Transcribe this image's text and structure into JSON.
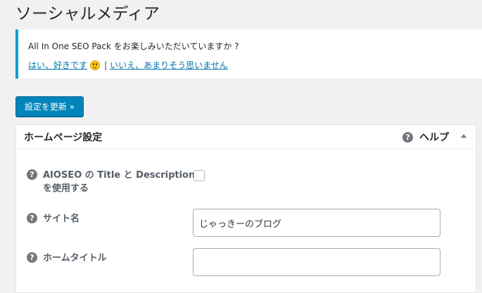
{
  "page": {
    "title": "ソーシャルメディア"
  },
  "notice": {
    "question": "All In One SEO Pack をお楽しみいただいていますか ?",
    "yes_link": "はい、好きです",
    "separator": "|",
    "no_link": "いいえ、あまりそう思いません"
  },
  "toolbar": {
    "update_label": "設定を更新 »"
  },
  "panel": {
    "title": "ホームページ設定",
    "help_label": "ヘルプ",
    "fields": [
      {
        "label_line1": "AIOSEO の Title と Description",
        "label_line2": "を使用する",
        "checked": false
      },
      {
        "label": "サイト名",
        "value": "じゃっきーのブログ"
      },
      {
        "label": "ホームタイトル",
        "value": ""
      }
    ]
  },
  "icons": {
    "help": "question-circle-icon",
    "collapse": "triangle-up-icon",
    "emoji": "smiley-face-icon"
  },
  "colors": {
    "accent": "#0085ba",
    "notice_border": "#00a0d2",
    "link": "#0073aa"
  }
}
